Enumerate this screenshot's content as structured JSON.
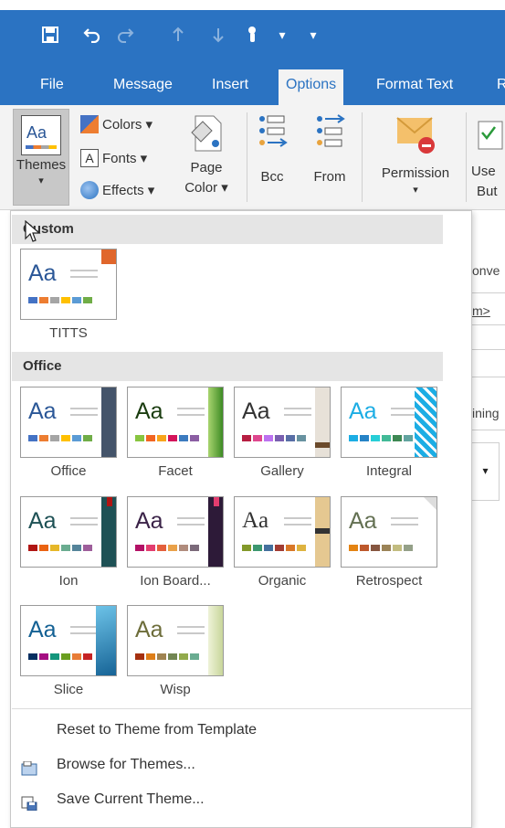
{
  "qat": {
    "icons": [
      "save-icon",
      "undo-icon",
      "redo-icon",
      "up-arrow-icon",
      "down-arrow-icon",
      "touch-mode-icon",
      "customize-icon"
    ]
  },
  "tabs": [
    {
      "label": "File",
      "active": false
    },
    {
      "label": "Message",
      "active": false
    },
    {
      "label": "Insert",
      "active": false
    },
    {
      "label": "Options",
      "active": true
    },
    {
      "label": "Format Text",
      "active": false
    },
    {
      "label": "R",
      "active": false
    }
  ],
  "ribbon": {
    "themes_label": "Themes",
    "themes_arrow": "▾",
    "colors_label": "Colors ▾",
    "fonts_label": "Fonts ▾",
    "effects_label": "Effects ▾",
    "page_color_label1": "Page",
    "page_color_label2": "Color ▾",
    "bcc_label": "Bcc",
    "from_label": "From",
    "permission_label": "Permission",
    "permission_arrow": "▾",
    "use_label1": "Use",
    "use_label2": "But"
  },
  "dropdown": {
    "custom_header": "Custom",
    "office_header": "Office",
    "custom_themes": [
      {
        "name": "TITTS"
      }
    ],
    "office_themes": [
      {
        "name": "Office"
      },
      {
        "name": "Facet"
      },
      {
        "name": "Gallery"
      },
      {
        "name": "Integral"
      },
      {
        "name": "Ion"
      },
      {
        "name": "Ion Board..."
      },
      {
        "name": "Organic"
      },
      {
        "name": "Retrospect"
      },
      {
        "name": "Slice"
      },
      {
        "name": "Wisp"
      }
    ],
    "reset_label": "Reset to Theme from Template",
    "browse_label": "Browse for Themes...",
    "save_label": "Save Current Theme..."
  },
  "background": {
    "text1": "onve",
    "text2": "m>",
    "text3": "ining"
  },
  "colors": {
    "accent": "#2b73c2",
    "ribbon": "#f3f3f3"
  }
}
